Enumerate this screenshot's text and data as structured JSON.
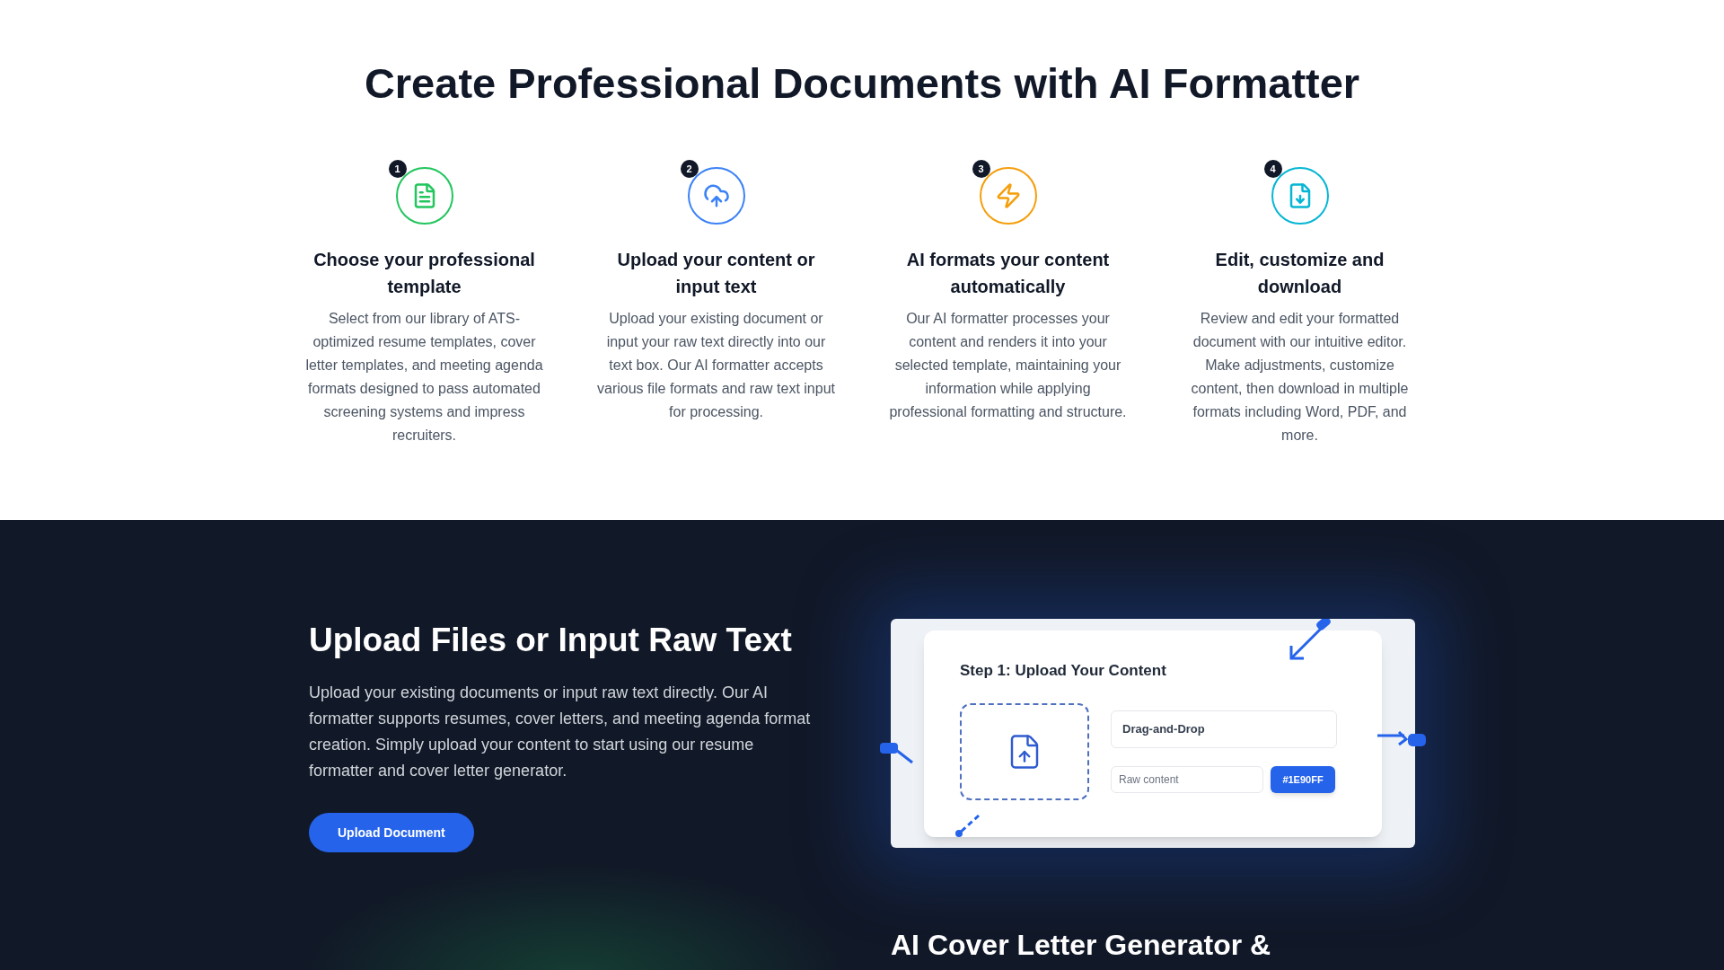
{
  "heading": "Create Professional Documents with AI Formatter",
  "steps": [
    {
      "number": "1",
      "title": "Choose your professional template",
      "description": "Select from our library of ATS-optimized resume templates, cover letter templates, and meeting agenda formats designed to pass automated screening systems and impress recruiters.",
      "color": "#22c55e"
    },
    {
      "number": "2",
      "title": "Upload your content or input text",
      "description": "Upload your existing document or input your raw text directly into our text box. Our AI formatter accepts various file formats and raw text input for processing.",
      "color": "#3b82f6"
    },
    {
      "number": "3",
      "title": "AI formats your content automatically",
      "description": "Our AI formatter processes your content and renders it into your selected template, maintaining your information while applying professional formatting and structure.",
      "color": "#f59e0b"
    },
    {
      "number": "4",
      "title": "Edit, customize and download",
      "description": "Review and edit your formatted document with our intuitive editor. Make adjustments, customize content, then download in multiple formats including Word, PDF, and more.",
      "color": "#06b6d4"
    }
  ],
  "upload_section": {
    "heading": "Upload Files or Input Raw Text",
    "text": "Upload your existing documents or input raw text directly. Our AI formatter supports resumes, cover letters, and meeting agenda format creation. Simply upload your content to start using our resume formatter and cover letter generator.",
    "button": "Upload Document",
    "mockup": {
      "title": "Step 1: Upload Your Content",
      "field_value": "Drag-and-Drop",
      "placeholder": "Raw content",
      "button": "#1E90FF"
    }
  },
  "next_section": {
    "heading": "AI Cover Letter Generator &"
  }
}
